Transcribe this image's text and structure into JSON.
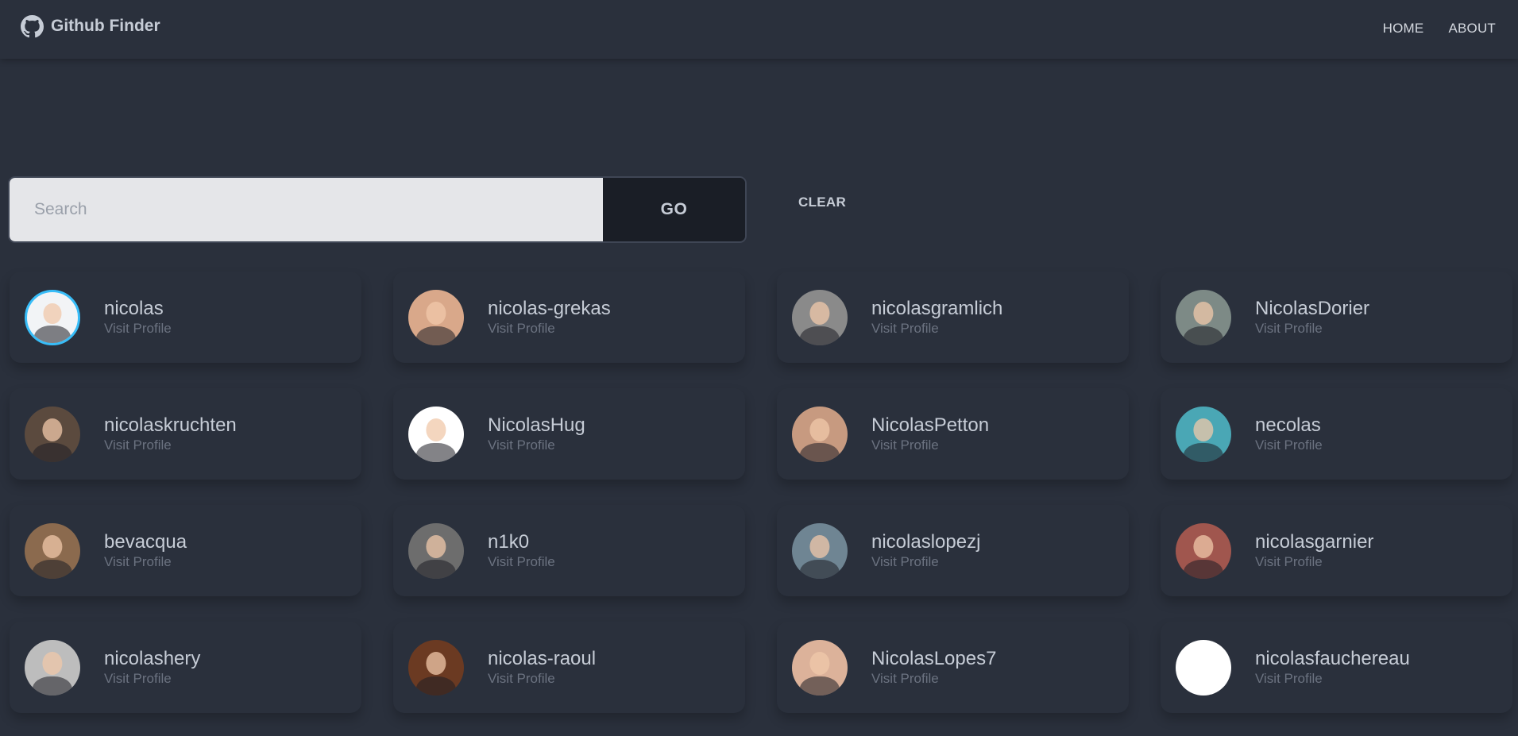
{
  "navbar": {
    "brand_icon": "github-icon",
    "title": "Github Finder",
    "links": {
      "home": "HOME",
      "about": "ABOUT"
    }
  },
  "search": {
    "placeholder": "Search",
    "value": "",
    "go_label": "GO",
    "clear_label": "CLEAR"
  },
  "users": [
    {
      "login": "nicolas",
      "link": "Visit Profile",
      "avatar_color": "#f2f4f6",
      "ring": "#38bdf8"
    },
    {
      "login": "nicolas-grekas",
      "link": "Visit Profile",
      "avatar_color": "#d9a88a",
      "ring": ""
    },
    {
      "login": "nicolasgramlich",
      "link": "Visit Profile",
      "avatar_color": "#8a8a8a",
      "ring": ""
    },
    {
      "login": "NicolasDorier",
      "link": "Visit Profile",
      "avatar_color": "#7d8a86",
      "ring": ""
    },
    {
      "login": "nicolaskruchten",
      "link": "Visit Profile",
      "avatar_color": "#5b4a3e",
      "ring": ""
    },
    {
      "login": "NicolasHug",
      "link": "Visit Profile",
      "avatar_color": "#ffffff",
      "ring": ""
    },
    {
      "login": "NicolasPetton",
      "link": "Visit Profile",
      "avatar_color": "#c79a80",
      "ring": ""
    },
    {
      "login": "necolas",
      "link": "Visit Profile",
      "avatar_color": "#4aa7b5",
      "ring": ""
    },
    {
      "login": "bevacqua",
      "link": "Visit Profile",
      "avatar_color": "#8b6a4e",
      "ring": ""
    },
    {
      "login": "n1k0",
      "link": "Visit Profile",
      "avatar_color": "#6d6d6d",
      "ring": ""
    },
    {
      "login": "nicolaslopezj",
      "link": "Visit Profile",
      "avatar_color": "#6f8593",
      "ring": ""
    },
    {
      "login": "nicolasgarnier",
      "link": "Visit Profile",
      "avatar_color": "#a0564e",
      "ring": ""
    },
    {
      "login": "nicolashery",
      "link": "Visit Profile",
      "avatar_color": "#bdbdbd",
      "ring": ""
    },
    {
      "login": "nicolas-raoul",
      "link": "Visit Profile",
      "avatar_color": "#6b3a22",
      "ring": ""
    },
    {
      "login": "NicolasLopes7",
      "link": "Visit Profile",
      "avatar_color": "#dcb29a",
      "ring": ""
    },
    {
      "login": "nicolasfauchereau",
      "link": "Visit Profile",
      "avatar_color": "#ffffff",
      "ring": ""
    }
  ]
}
